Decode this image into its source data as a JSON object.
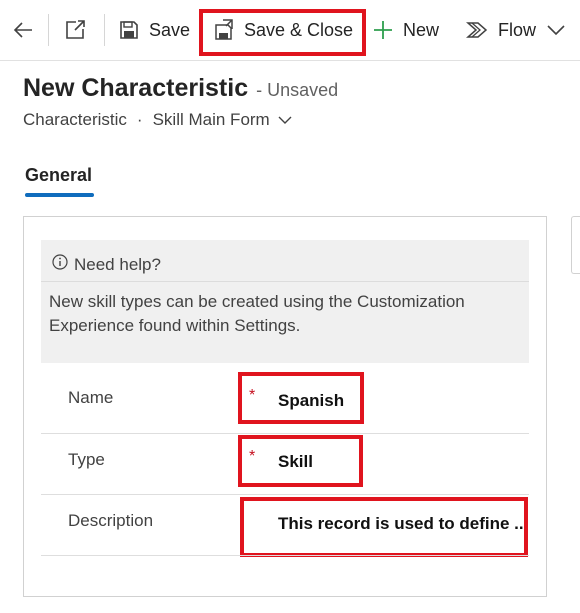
{
  "toolbar": {
    "save_label": "Save",
    "save_close_label": "Save & Close",
    "new_label": "New",
    "flow_label": "Flow",
    "icons": [
      "back-arrow-icon",
      "open-new-window-icon",
      "save-icon",
      "save-close-icon",
      "plus-icon",
      "flow-icon",
      "chevron-down-icon"
    ]
  },
  "header": {
    "title": "New Characteristic",
    "status": "- Unsaved",
    "entity": "Characteristic",
    "separator": "·",
    "form_name": "Skill Main Form"
  },
  "tabs": [
    {
      "label": "General",
      "selected": true
    }
  ],
  "help": {
    "heading": "Need help?",
    "text": "New skill types can be created using the Customization Experience found within Settings."
  },
  "fields": [
    {
      "label": "Name",
      "required": true,
      "value": "Spanish"
    },
    {
      "label": "Type",
      "required": true,
      "value": "Skill"
    },
    {
      "label": "Description",
      "required": false,
      "value": "This record is used to define ..."
    }
  ],
  "required_marker": "*",
  "colors": {
    "highlight": "#e0141e",
    "accent": "#0f6cbd",
    "required": "#c50f1f",
    "new_icon": "#2e9e4e",
    "help_bg": "#f0f0f0"
  }
}
